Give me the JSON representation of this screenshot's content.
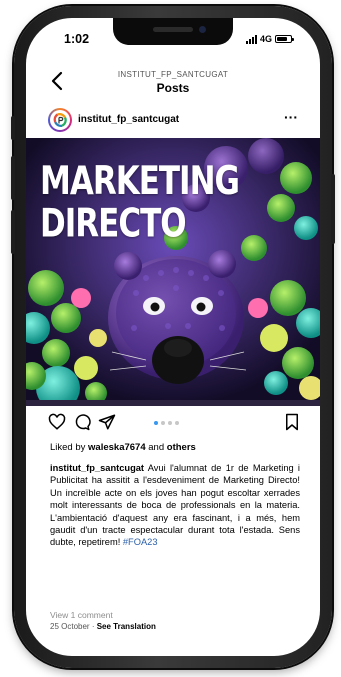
{
  "status_bar": {
    "time": "1:02",
    "network": "4G"
  },
  "header": {
    "account": "INSTITUT_FP_SANTCUGAT",
    "title": "Posts"
  },
  "post": {
    "username": "institut_fp_santcugat",
    "image_headline": [
      "MARKETING",
      "DIRECTO"
    ],
    "liked_by_prefix": "Liked by",
    "liked_by_user": "waleska7674",
    "liked_by_and": "and",
    "liked_by_others": "others",
    "caption_user": "institut_fp_santcugat",
    "caption_text": "Avui l'alumnat de 1r de Marketing i Publicitat ha assitit a l'esdeveniment de Marketing Directo! Un increïble acte on els joves han pogut escoltar xerrades molt interessants de boca de professionals en la materia. L'ambientació d'aquest any era fascinant, i a més, hem gaudit d'un tracte espectacular durant tota l'estada. Sens dubte, repetirem!",
    "hashtag": "#FOA23",
    "comments_link": "View 1 comment",
    "date": "25 October",
    "date_separator": "·",
    "see_translation": "See Translation",
    "carousel": {
      "count": 4,
      "active": 1
    }
  },
  "colors": {
    "hashtag": "#2b5fa8",
    "carousel_active": "#3897f0"
  },
  "icons": [
    "back-chevron-icon",
    "more-dots-icon",
    "heart-icon",
    "comment-icon",
    "share-icon",
    "bookmark-icon"
  ]
}
